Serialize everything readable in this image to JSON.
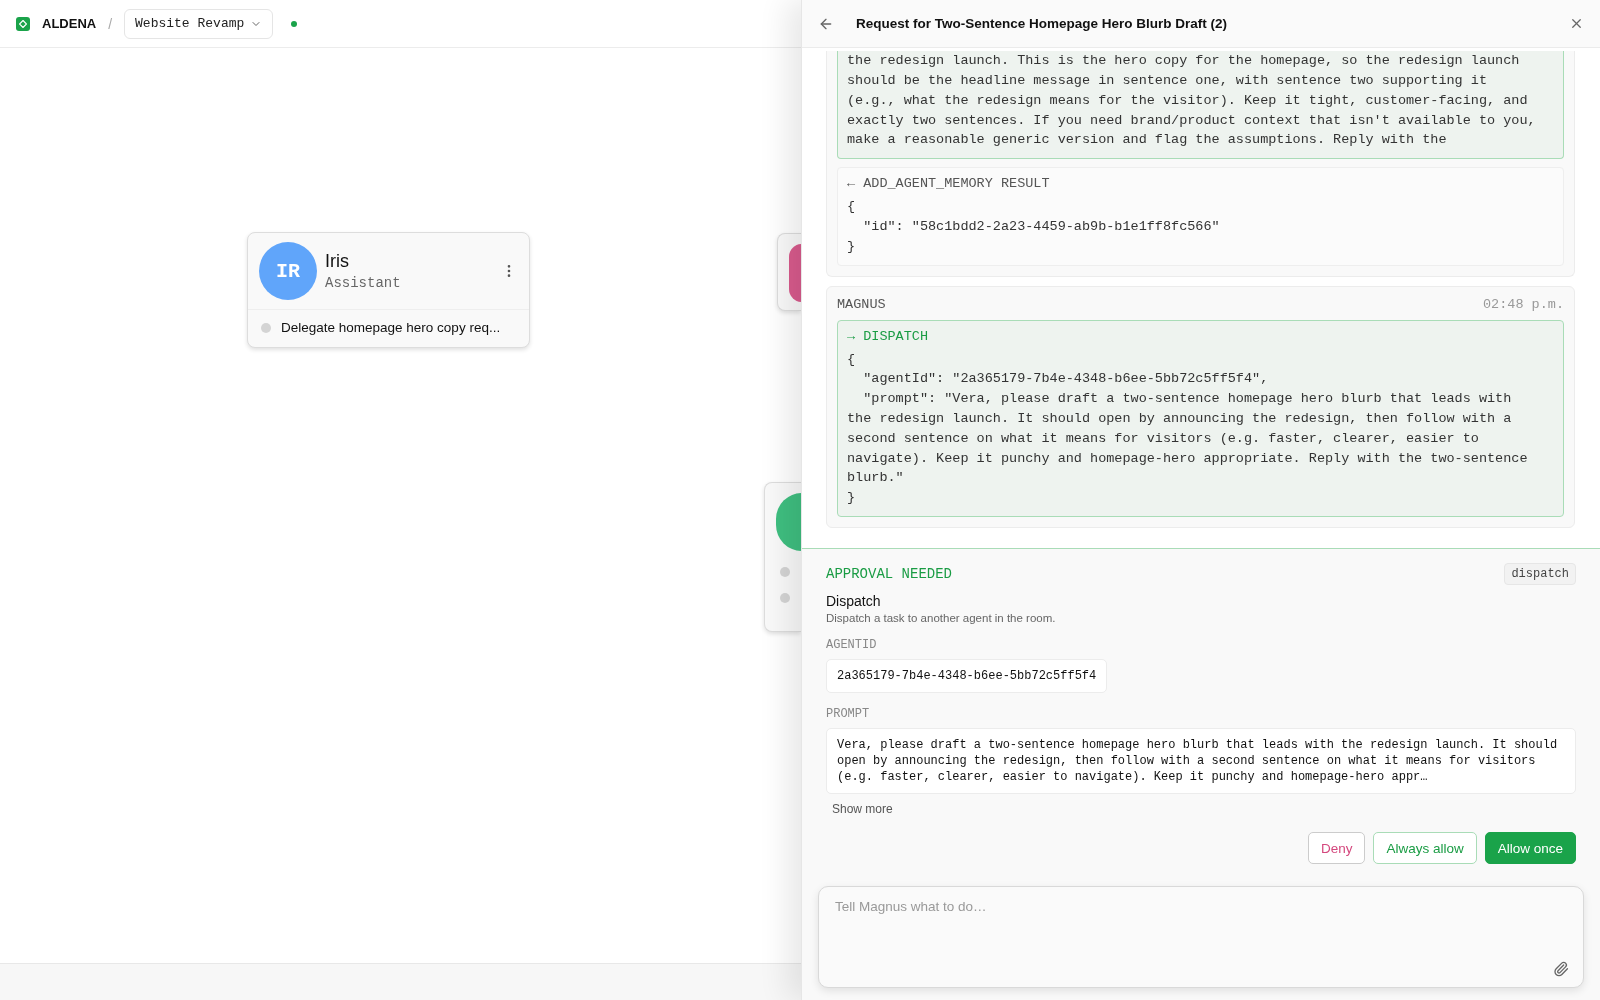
{
  "topbar": {
    "brand": "ALDENA",
    "separator": "/",
    "project": "Website Revamp",
    "online": true
  },
  "nodes": [
    {
      "initials": "IR",
      "name": "Iris",
      "role": "Assistant",
      "color": "#60a5fa",
      "tasks": [
        {
          "label": "Delegate homepage hero copy req..."
        }
      ]
    }
  ],
  "covered_nodes": [
    {
      "kind": "compact",
      "color": "#d95b8d"
    },
    {
      "kind": "with_tasks",
      "color": "#3fbf80"
    }
  ],
  "panel": {
    "title": "Request for Two-Sentence Homepage Hero Blurb Draft (2)",
    "messages": [
      {
        "blocks": [
          {
            "kind": "call",
            "code": "the redesign launch. This is the hero copy for the homepage, so the redesign launch should be the headline message in sentence one, with sentence two supporting it (e.g., what the redesign means for the visitor). Keep it tight, customer-facing, and exactly two sentences. If you need brand/product context that isn't available to you, make a reasonable generic version and flag the assumptions. Reply with the"
          },
          {
            "kind": "result",
            "arrow": "←",
            "label": "ADD_AGENT_MEMORY RESULT",
            "code": "{\n  \"id\": \"58c1bdd2-2a23-4459-ab9b-b1e1ff8fc566\"\n}"
          }
        ]
      },
      {
        "sender": "MAGNUS",
        "time": "02:48 p.m.",
        "blocks": [
          {
            "kind": "call",
            "arrow": "→",
            "label": "DISPATCH",
            "code": "{\n  \"agentId\": \"2a365179-7b4e-4348-b6ee-5bb72c5ff5f4\",\n  \"prompt\": \"Vera, please draft a two-sentence homepage hero blurb that leads with the redesign launch. It should open by announcing the redesign, then follow with a second sentence on what it means for visitors (e.g. faster, clearer, easier to navigate). Keep it punchy and homepage-hero appropriate. Reply with the two-sentence blurb.\"\n}"
          }
        ]
      }
    ],
    "approval": {
      "title": "APPROVAL NEEDED",
      "tag": "dispatch",
      "tool": "Dispatch",
      "description": "Dispatch a task to another agent in the room.",
      "fields": [
        {
          "label": "AGENTID",
          "kind": "inline",
          "value": "2a365179-7b4e-4348-b6ee-5bb72c5ff5f4"
        },
        {
          "label": "PROMPT",
          "kind": "block",
          "value": "Vera, please draft a two-sentence homepage hero blurb that leads with the redesign launch. It should open by announcing the redesign, then follow with a second sentence on what it means for visitors (e.g. faster, clearer, easier to navigate). Keep it punchy and homepage-hero appr…"
        }
      ],
      "show_more": "Show more",
      "buttons": [
        {
          "label": "Deny",
          "kind": "deny"
        },
        {
          "label": "Always allow",
          "kind": "secondary"
        },
        {
          "label": "Allow once",
          "kind": "primary"
        }
      ]
    },
    "composer": {
      "placeholder": "Tell Magnus what to do…"
    }
  }
}
